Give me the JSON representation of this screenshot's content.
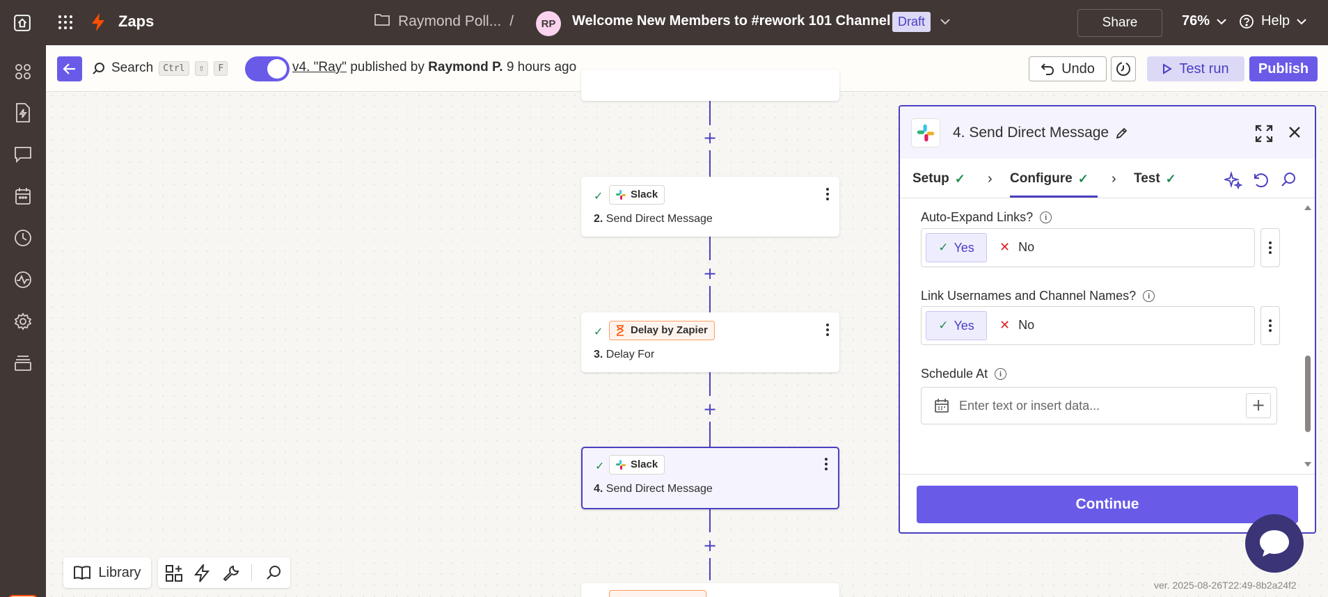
{
  "topbar": {
    "app_title": "Zaps",
    "folder": "Raymond Poll...",
    "separator": "/",
    "avatar_initials": "RP",
    "zap_name": "Welcome New Members to #rework 101 Channel",
    "status": "Draft",
    "share_label": "Share",
    "zoom": "76%",
    "help_label": "Help"
  },
  "subbar": {
    "search_label": "Search",
    "shortcut_keys": [
      "Ctrl",
      "⇧",
      "F"
    ],
    "version_link": "v4. \"Ray\"",
    "published_by_text": "published by",
    "author": "Raymond P.",
    "time_ago": "9 hours ago",
    "undo_label": "Undo",
    "test_run_label": "Test run",
    "publish_label": "Publish"
  },
  "steps": [
    {
      "app": "Slack",
      "number": "2.",
      "title": "Send Direct Message",
      "selected": false
    },
    {
      "app": "Delay by Zapier",
      "number": "3.",
      "title": "Delay For",
      "selected": false
    },
    {
      "app": "Slack",
      "number": "4.",
      "title": "Send Direct Message",
      "selected": true
    }
  ],
  "panel": {
    "title": "4. Send Direct Message",
    "tabs": [
      {
        "label": "Setup",
        "done": true
      },
      {
        "label": "Configure",
        "done": true,
        "active": true
      },
      {
        "label": "Test",
        "done": true
      }
    ],
    "fields": [
      {
        "label": "Auto-Expand Links?",
        "yes": "Yes",
        "no": "No",
        "value": "Yes"
      },
      {
        "label": "Link Usernames and Channel Names?",
        "yes": "Yes",
        "no": "No",
        "value": "Yes"
      }
    ],
    "schedule": {
      "label": "Schedule At",
      "placeholder": "Enter text or insert data..."
    },
    "continue_label": "Continue"
  },
  "bottom": {
    "library_label": "Library",
    "version_string": "ver. 2025-08-26T22:49-8b2a24f2"
  },
  "colors": {
    "accent": "#695be8",
    "topbar": "#413735",
    "success": "#1d8b4d",
    "brand_orange": "#ff4f00"
  }
}
